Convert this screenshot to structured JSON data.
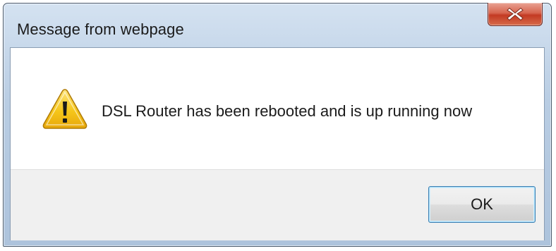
{
  "dialog": {
    "title": "Message from webpage",
    "close_icon": "close-x-icon",
    "icon": "warning-icon",
    "message": "DSL Router has been rebooted and is up running now",
    "ok_label": "OK"
  },
  "colors": {
    "titlebar": "#b9cde3",
    "close_button": "#c33a23",
    "warning_yellow": "#f6c61a",
    "button_area": "#f0f0f0",
    "ok_border": "#3c7fb1"
  }
}
